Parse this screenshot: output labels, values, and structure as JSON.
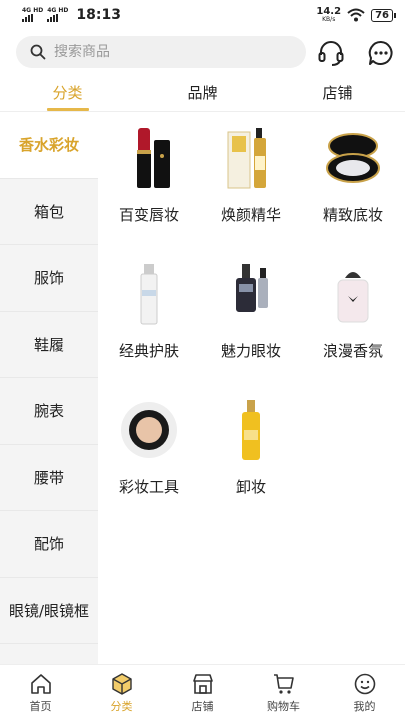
{
  "status_bar": {
    "network1": "4G HD",
    "network2": "4G HD",
    "time": "18:13",
    "speed_value": "14.2",
    "speed_unit": "KB/s",
    "battery": "76"
  },
  "search": {
    "placeholder": "搜索商品",
    "value": ""
  },
  "header_icons": [
    "headset-icon",
    "chat-icon"
  ],
  "tabs": [
    {
      "label": "分类",
      "active": true
    },
    {
      "label": "品牌",
      "active": false
    },
    {
      "label": "店铺",
      "active": false
    }
  ],
  "sidebar": {
    "items": [
      {
        "label": "香水彩妆",
        "active": true
      },
      {
        "label": "箱包",
        "active": false
      },
      {
        "label": "服饰",
        "active": false
      },
      {
        "label": "鞋履",
        "active": false
      },
      {
        "label": "腕表",
        "active": false
      },
      {
        "label": "腰带",
        "active": false
      },
      {
        "label": "配饰",
        "active": false
      },
      {
        "label": "眼镜/眼镜框",
        "active": false
      }
    ]
  },
  "categories": [
    {
      "label": "百变唇妆",
      "icon": "lipstick-icon"
    },
    {
      "label": "焕颜精华",
      "icon": "serum-bottle-icon"
    },
    {
      "label": "精致底妆",
      "icon": "compact-powder-icon"
    },
    {
      "label": "经典护肤",
      "icon": "skincare-tube-icon"
    },
    {
      "label": "魅力眼妆",
      "icon": "eye-serum-icon"
    },
    {
      "label": "浪漫香氛",
      "icon": "perfume-icon"
    },
    {
      "label": "彩妆工具",
      "icon": "cushion-compact-icon"
    },
    {
      "label": "卸妆",
      "icon": "cleansing-oil-icon"
    }
  ],
  "bottom_nav": [
    {
      "label": "首页",
      "icon": "home-icon",
      "active": false
    },
    {
      "label": "分类",
      "icon": "category-box-icon",
      "active": true
    },
    {
      "label": "店铺",
      "icon": "store-icon",
      "active": false
    },
    {
      "label": "购物车",
      "icon": "cart-icon",
      "active": false
    },
    {
      "label": "我的",
      "icon": "profile-icon",
      "active": false
    }
  ],
  "colors": {
    "accent": "#d9a42c",
    "sidebar_bg": "#f4f4f4"
  }
}
